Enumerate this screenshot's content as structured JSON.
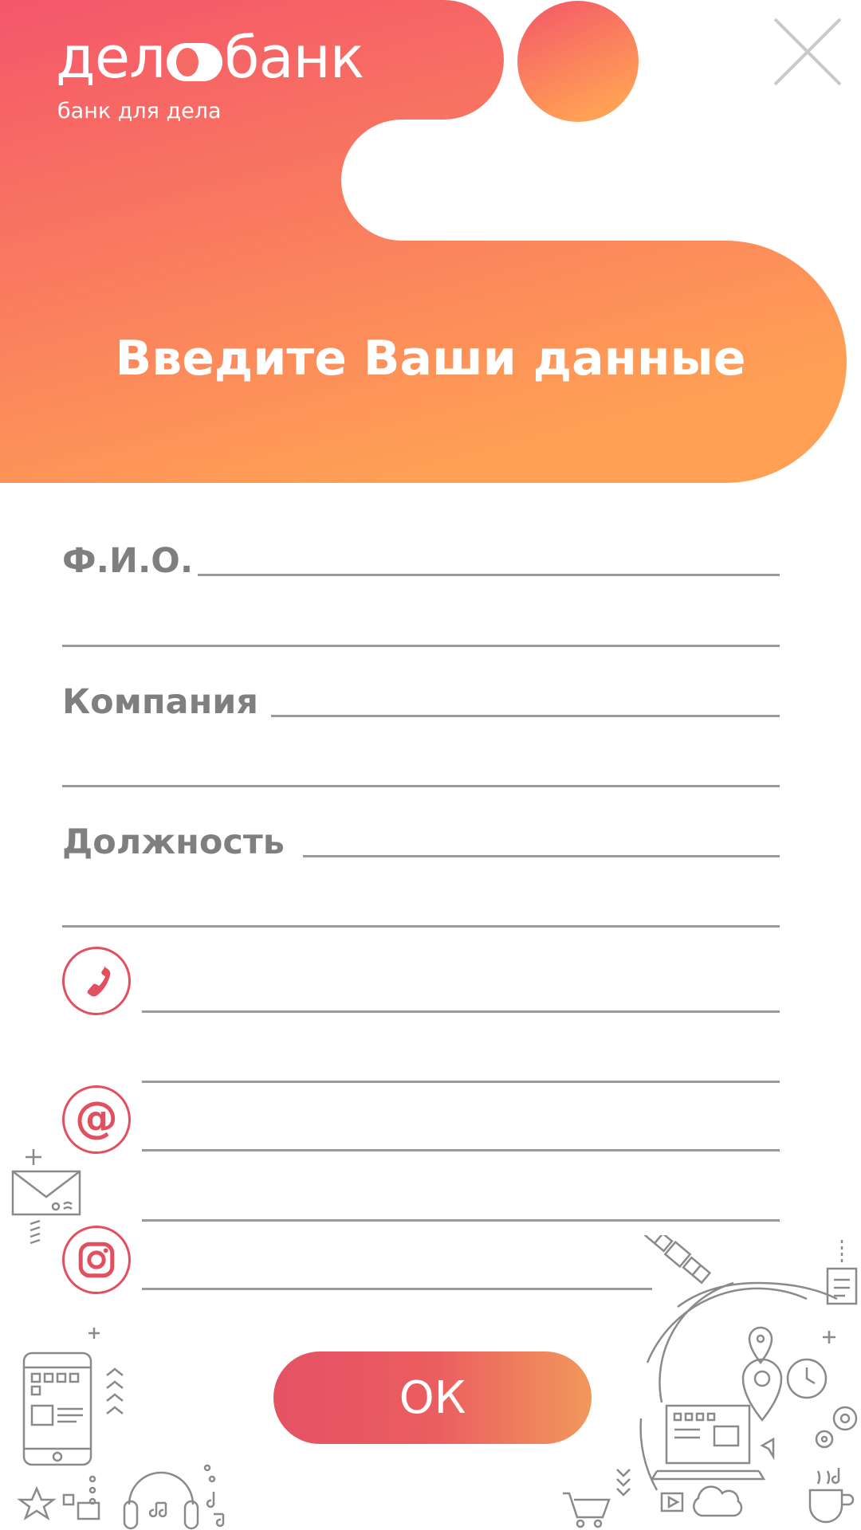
{
  "brand": {
    "left_part": "дел",
    "right_part": "банк",
    "tagline": "банк для дела"
  },
  "header": {
    "title": "Введите Ваши данные"
  },
  "form": {
    "fio_label": "Ф.И.О.",
    "company_label": "Компания",
    "position_label": "Должность",
    "phone_icon": "phone-icon",
    "email_icon": "at-icon",
    "instagram_icon": "instagram-icon"
  },
  "actions": {
    "ok_label": "ОК",
    "close_icon": "close-icon"
  },
  "colors": {
    "gradient_start": "#f4566a",
    "gradient_end": "#ffa055",
    "accent": "#e2505f",
    "label_gray": "#7f7f7f",
    "line_gray": "#9a9a9a"
  }
}
